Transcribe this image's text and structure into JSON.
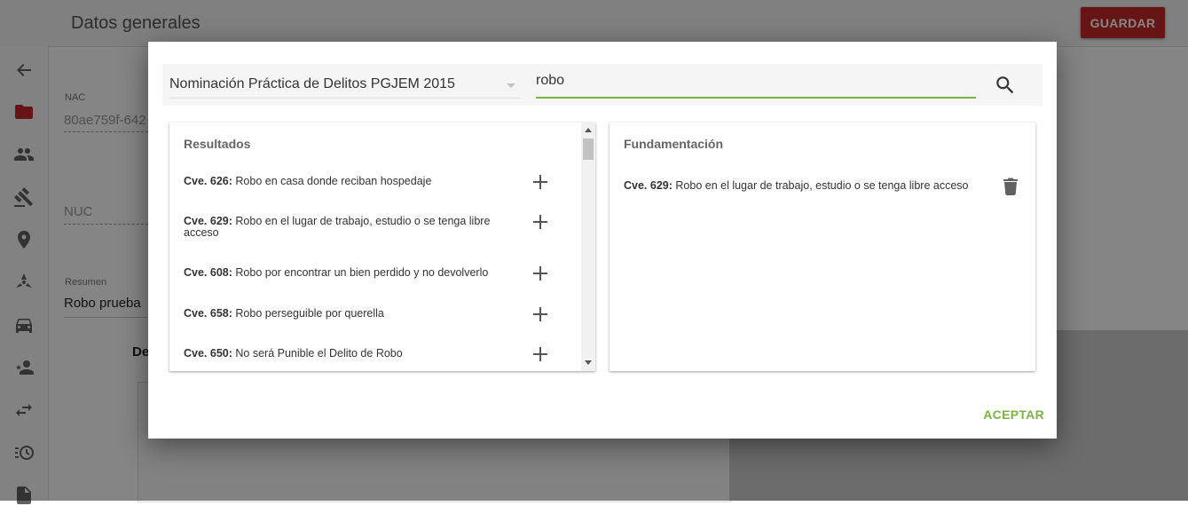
{
  "app": {
    "title": "Datos generales",
    "save_label": "GUARDAR",
    "nac_label": "NAC",
    "nac_value": "80ae759f-642",
    "nuc_label": "NUC",
    "resumen_label": "Resumen",
    "resumen_value": "Robo prueba",
    "partial_heading": "De",
    "sidebar_icons": [
      "back-arrow-icon",
      "folder-icon",
      "people-icon",
      "gavel-icon",
      "location-icon",
      "radiation-icon",
      "car-icon",
      "person-star-icon",
      "swap-icon",
      "history-icon",
      "document-icon"
    ]
  },
  "colors": {
    "accent": "#7cb342",
    "save_button": "#c62828",
    "folder_icon": "#c62828"
  },
  "dialog": {
    "catalog": "Nominación Práctica de Delitos PGJEM 2015",
    "search_value": "robo",
    "results_title": "Resultados",
    "results": [
      {
        "code": "Cve. 626:",
        "text": "Robo en casa donde reciban hospedaje"
      },
      {
        "code": "Cve. 629:",
        "text": "Robo en el lugar de trabajo, estudio o se tenga libre acceso"
      },
      {
        "code": "Cve. 608:",
        "text": "Robo por encontrar un bien perdido y no devolverlo"
      },
      {
        "code": "Cve. 658:",
        "text": "Robo perseguible por querella"
      },
      {
        "code": "Cve. 650:",
        "text": "No será Punible el Delito de Robo"
      }
    ],
    "fundamentacion_title": "Fundamentación",
    "selected": [
      {
        "code": "Cve. 629:",
        "text": "Robo en el lugar de trabajo, estudio o se tenga libre acceso"
      }
    ],
    "accept_label": "ACEPTAR"
  }
}
